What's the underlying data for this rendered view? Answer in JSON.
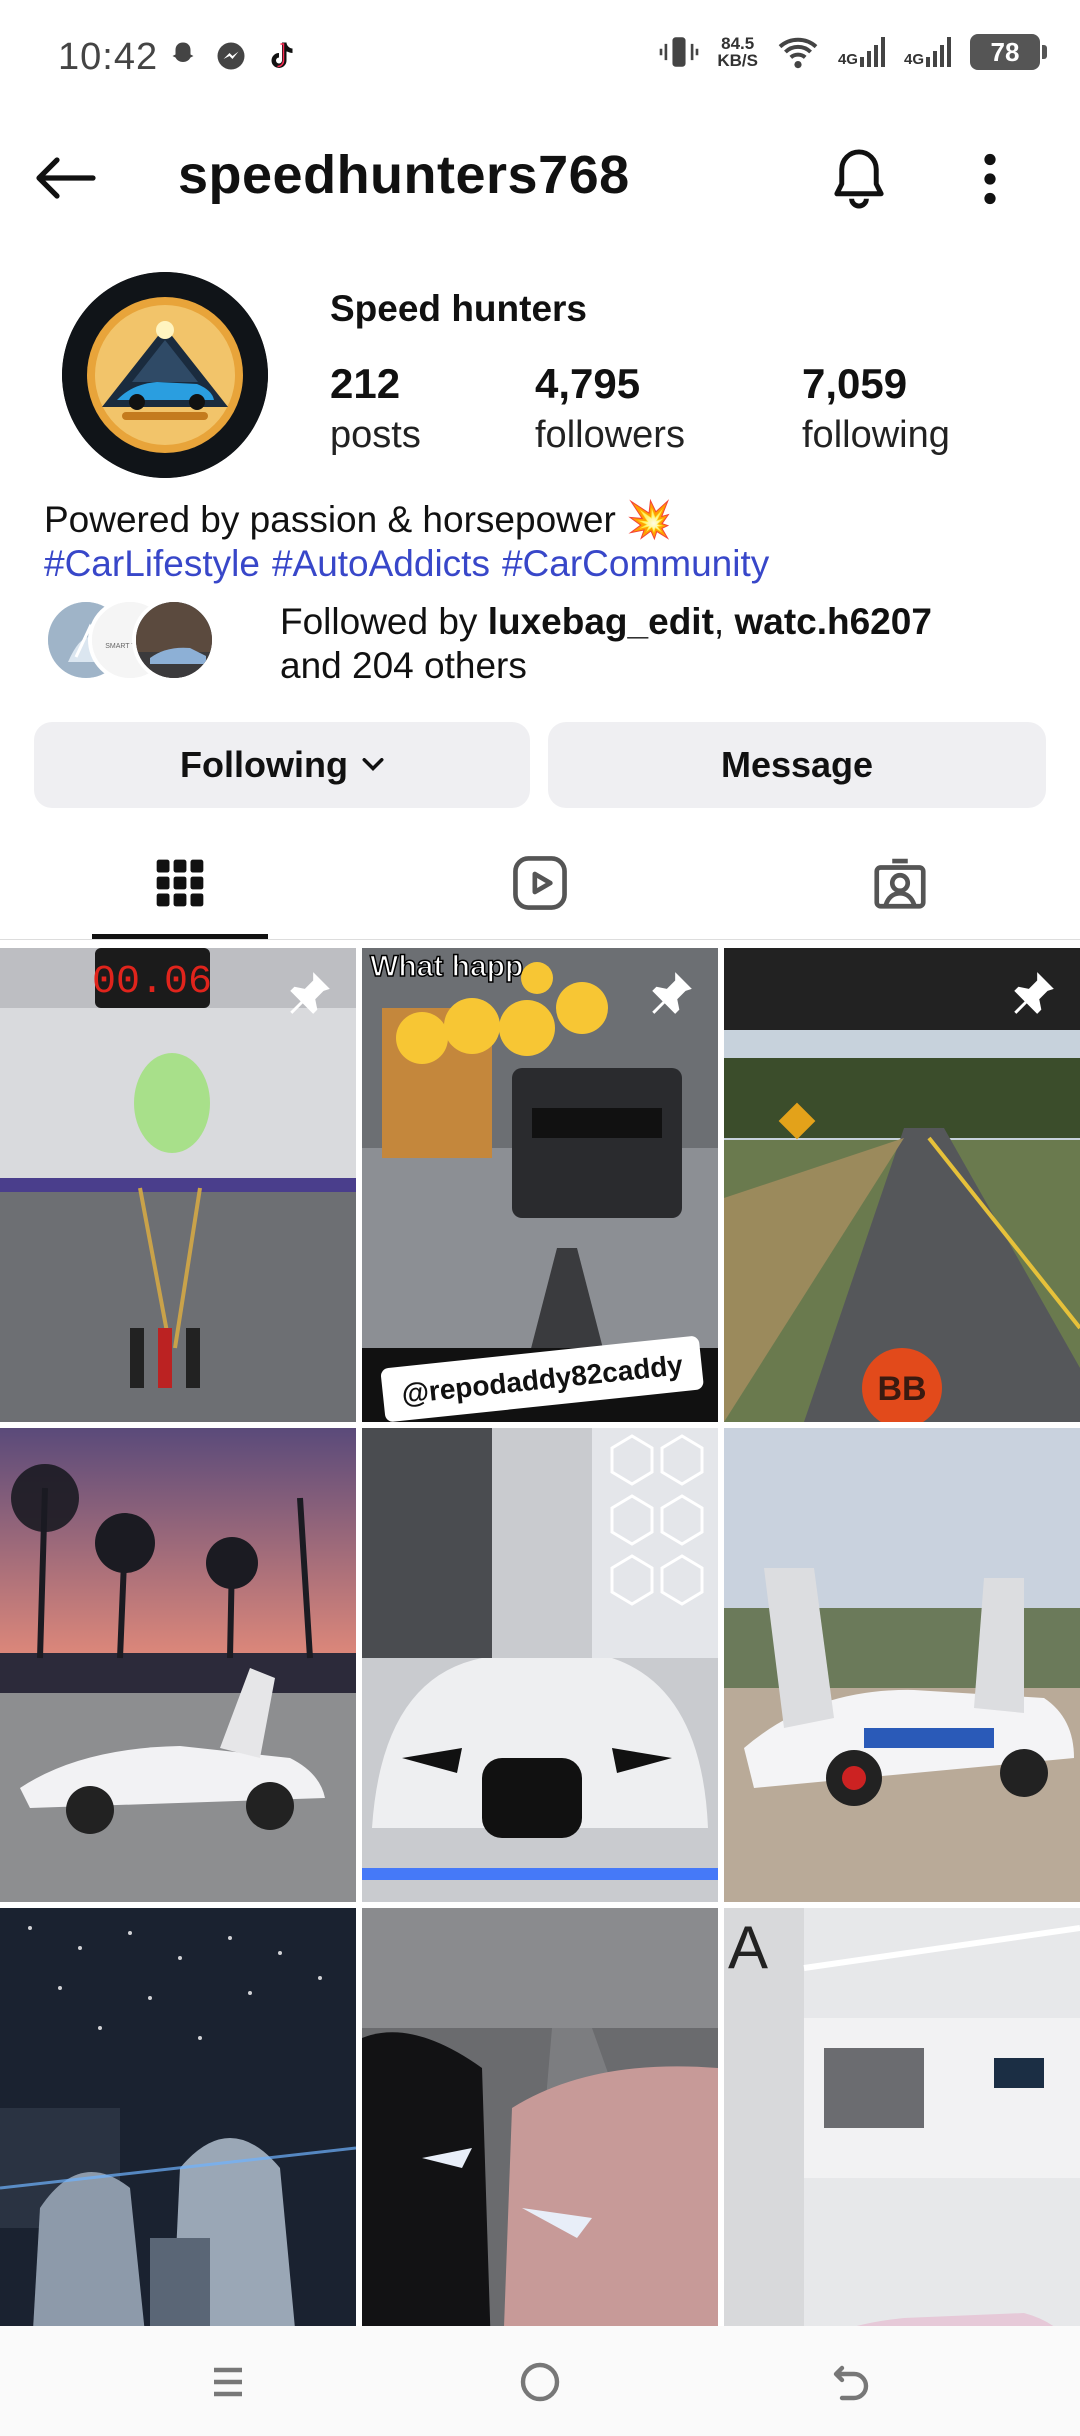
{
  "status_bar": {
    "time": "10:42",
    "speed_value": "84.5",
    "speed_unit": "KB/S",
    "net1": "4G",
    "net2": "4G",
    "battery": "78"
  },
  "header": {
    "username": "speedhunters768"
  },
  "profile": {
    "display_name": "Speed hunters",
    "stats": {
      "posts_count": "212",
      "posts_label": "posts",
      "followers_count": "4,795",
      "followers_label": "followers",
      "following_count": "7,059",
      "following_label": "following"
    },
    "bio": "Powered by passion & horsepower 💥",
    "hashtags": [
      "#CarLifestyle",
      "#AutoAddicts",
      "#CarCommunity"
    ],
    "followed_by": {
      "prefix": "Followed by ",
      "user1": "luxebag_edit",
      "separator": ", ",
      "user2": "watc.h6207",
      "suffix": "and 204 others"
    },
    "mutual_avatar2_text": "SMART TRADING"
  },
  "actions": {
    "following_label": "Following",
    "message_label": "Message"
  },
  "grid": {
    "post2_caption_top": "What happ",
    "post2_caption_bottom": "@repodaddy82caddy",
    "post1_timer": "00.06",
    "post3_logo": "BB"
  },
  "colors": {
    "link": "#3847c9",
    "button_bg": "#efeff2",
    "text": "#111111"
  }
}
